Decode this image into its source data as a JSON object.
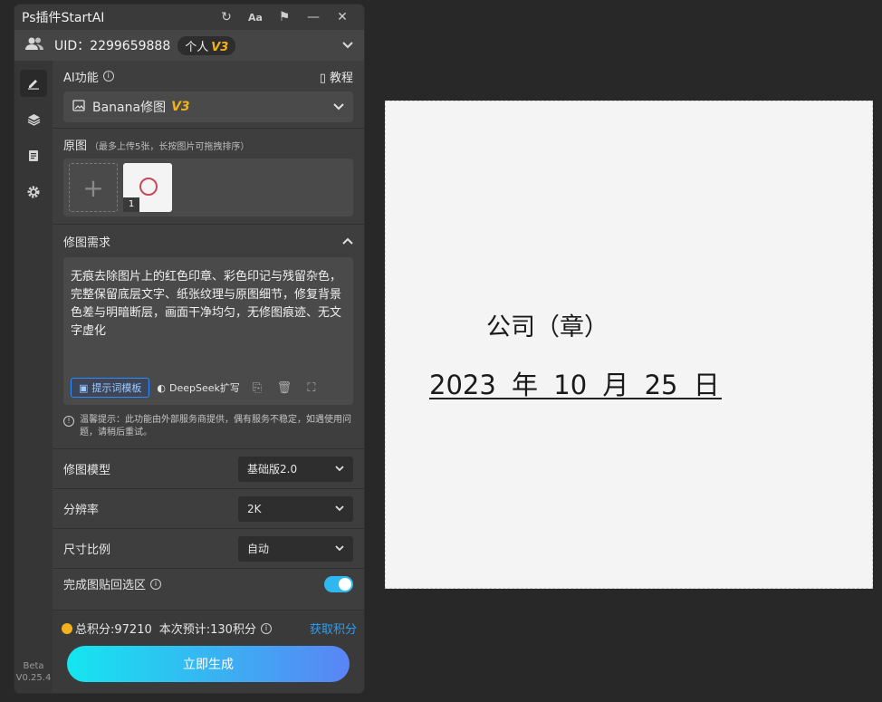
{
  "app": {
    "title": "Ps插件StartAI"
  },
  "titlebar": {
    "refresh_icon": "↻",
    "font_icon": "Aa",
    "pin_icon": "⚑",
    "minimize_icon": "—",
    "close_icon": "✕"
  },
  "user": {
    "uid_text": "UID：2299659888",
    "plan": "个人",
    "version_badge": "V3"
  },
  "sidebar": {
    "beta_label": "Beta",
    "version": "V0.25.4"
  },
  "ai": {
    "label": "AI功能",
    "tutorial_label": "教程",
    "selected_function": "Banana修图",
    "selected_version": "V3"
  },
  "original": {
    "label": "原图",
    "hint": "（最多上传5张，长按图片可拖拽排序）",
    "thumb_number": "1"
  },
  "request": {
    "label": "修图需求",
    "text": "无痕去除图片上的红色印章、彩色印记与残留杂色，完整保留底层文字、纸张纹理与原图细节，修复背景色差与明暗断层，画面干净均匀，无修图痕迹、无文字虚化",
    "template_button": "提示词模板",
    "deepseek_button": "DeepSeek扩写",
    "notice": "温馨提示：此功能由外部服务商提供，偶有服务不稳定，如遇使用问题，请稍后重试。"
  },
  "options": {
    "model_label": "修图模型",
    "model_value": "基础版2.0",
    "resolution_label": "分辨率",
    "resolution_value": "2K",
    "ratio_label": "尺寸比例",
    "ratio_value": "自动",
    "paste_back_label": "完成图贴回选区",
    "paste_back_enabled": true
  },
  "footer": {
    "total_points": "总积分:97210",
    "estimate": "本次预计:130积分",
    "get_points": "获取积分",
    "generate_button": "立即生成"
  },
  "document": {
    "line1": "公司（章）",
    "line2": "2023 年 10 月 25 日"
  }
}
